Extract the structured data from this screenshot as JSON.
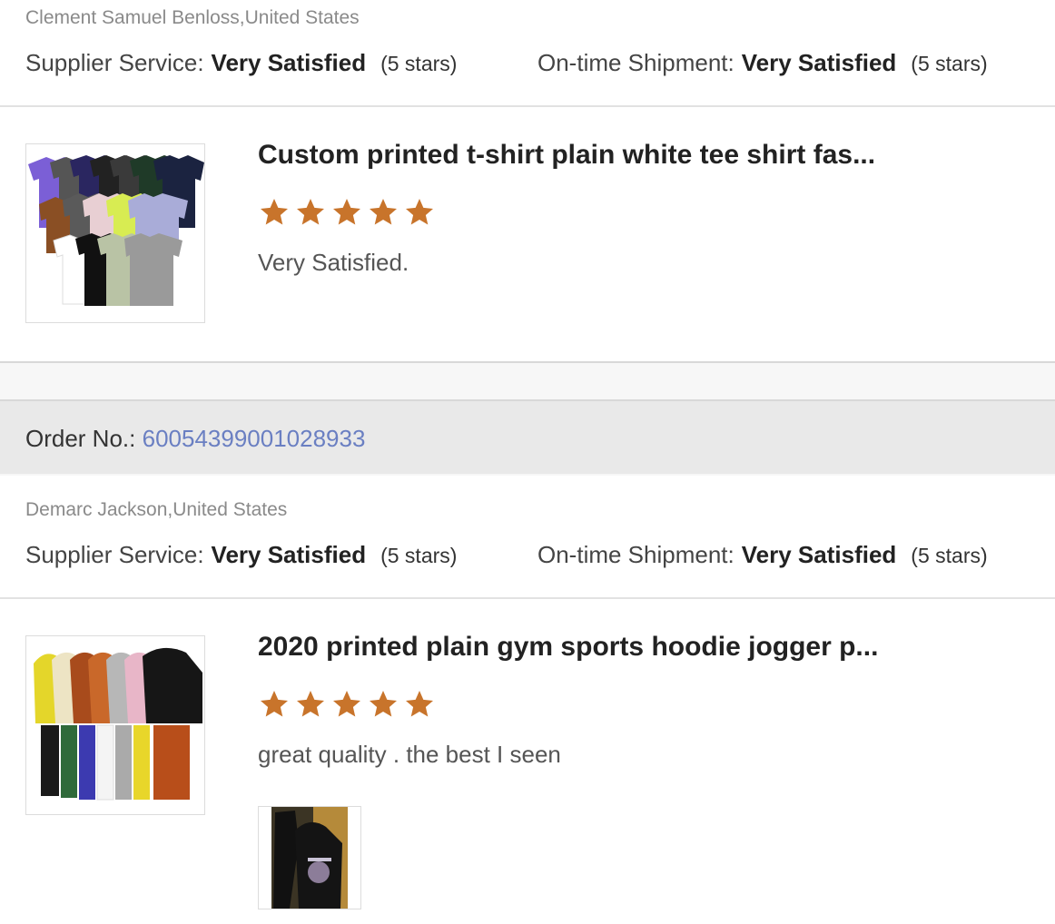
{
  "reviews": [
    {
      "reviewer": "Clement Samuel Benloss,United States",
      "supplier_service_label": "Supplier Service:",
      "supplier_service_value": "Very Satisfied",
      "supplier_service_stars": "(5 stars)",
      "shipment_label": "On-time Shipment:",
      "shipment_value": "Very Satisfied",
      "shipment_stars": "(5 stars)",
      "product_title": "Custom printed t-shirt plain white tee shirt fas...",
      "rating": 5,
      "comment": "Very Satisfied."
    },
    {
      "order_label": "Order No.:",
      "order_number": "60054399001028933",
      "reviewer": "Demarc Jackson,United States",
      "supplier_service_label": "Supplier Service:",
      "supplier_service_value": "Very Satisfied",
      "supplier_service_stars": "(5 stars)",
      "shipment_label": "On-time Shipment:",
      "shipment_value": "Very Satisfied",
      "shipment_stars": "(5 stars)",
      "product_title": "2020 printed plain gym sports hoodie jogger p...",
      "rating": 5,
      "comment": "great quality . the best I seen"
    }
  ],
  "colors": {
    "star": "#c8742b",
    "order_link": "#6a7fc2"
  },
  "icons": {
    "star": "star-icon"
  }
}
